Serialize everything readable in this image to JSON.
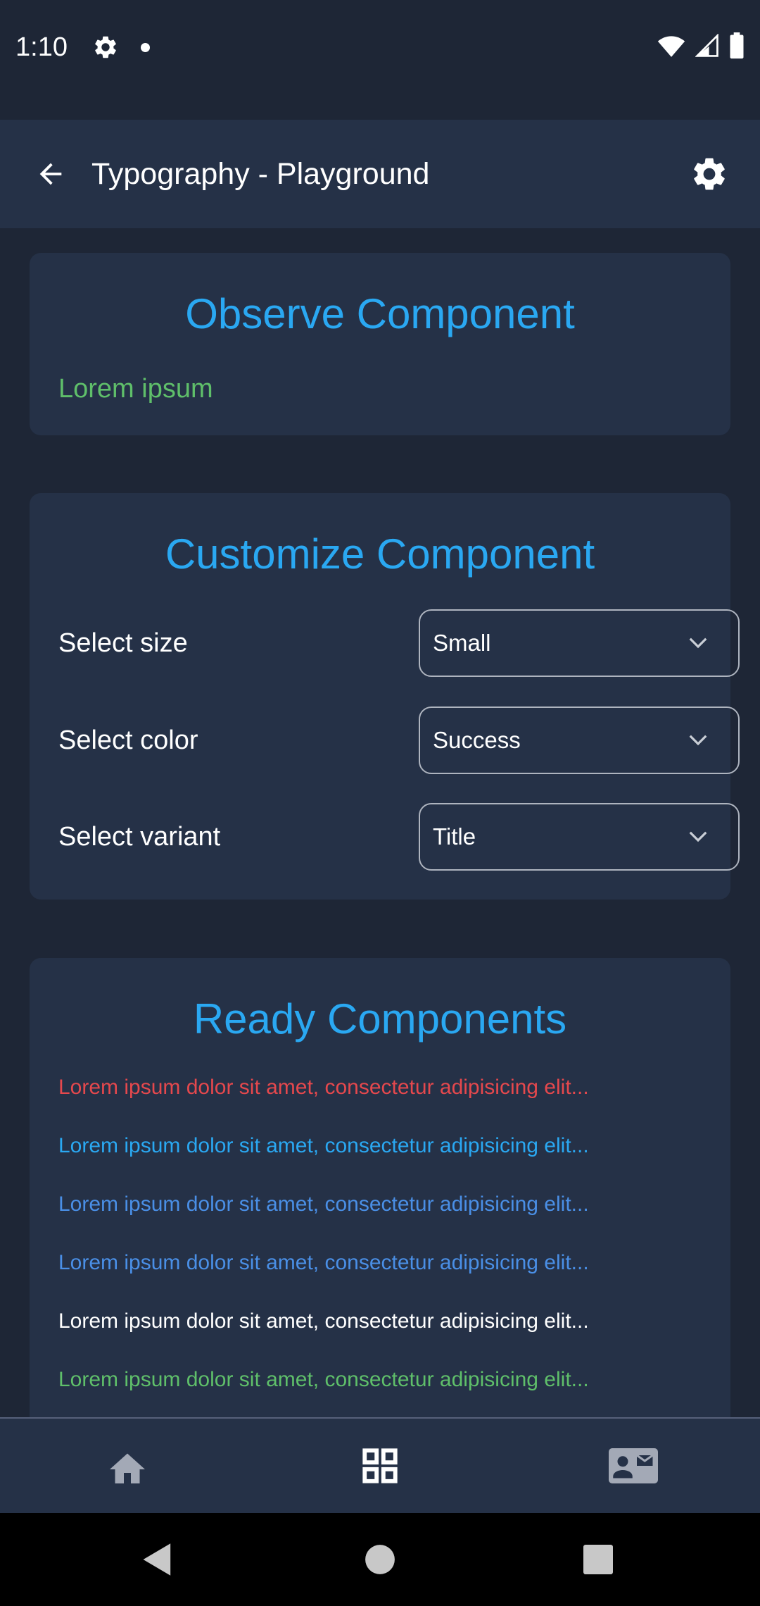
{
  "status_bar": {
    "time": "1:10",
    "icons": [
      "settings-icon",
      "notification-dot",
      "wifi-icon",
      "signal-icon",
      "battery-icon"
    ]
  },
  "app_bar": {
    "title": "Typography - Playground",
    "back_icon": "arrow-back-icon",
    "settings_icon": "gear-icon"
  },
  "observe": {
    "title": "Observe Component",
    "preview_text": "Lorem ipsum",
    "preview_color": "#5fbf6a"
  },
  "customize": {
    "title": "Customize Component",
    "rows": [
      {
        "label": "Select size",
        "value": "Small"
      },
      {
        "label": "Select color",
        "value": "Success"
      },
      {
        "label": "Select variant",
        "value": "Title"
      }
    ]
  },
  "ready": {
    "title": "Ready Components",
    "lines": [
      {
        "text": "Lorem ipsum dolor sit amet, consectetur adipisicing elit...",
        "color": "#e5484d"
      },
      {
        "text": "Lorem ipsum dolor sit amet, consectetur adipisicing elit...",
        "color": "#2aa8f2"
      },
      {
        "text": "Lorem ipsum dolor sit amet, consectetur adipisicing elit...",
        "color": "#4a8fe6"
      },
      {
        "text": "Lorem ipsum dolor sit amet, consectetur adipisicing elit...",
        "color": "#4a8fe6"
      },
      {
        "text": "Lorem ipsum dolor sit amet, consectetur adipisicing elit...",
        "color": "#ffffff"
      },
      {
        "text": "Lorem ipsum dolor sit amet, consectetur adipisicing elit...",
        "color": "#5fbf6a"
      }
    ]
  },
  "bottom_nav": {
    "items": [
      "home-icon",
      "grid-icon",
      "contact-mail-icon"
    ]
  },
  "system_nav": {
    "items": [
      "back-triangle-icon",
      "home-circle-icon",
      "recents-square-icon"
    ]
  },
  "colors": {
    "background": "#1e2636",
    "surface": "#253147",
    "accent": "#2aa8f2",
    "success": "#5fbf6a",
    "danger": "#e5484d"
  }
}
